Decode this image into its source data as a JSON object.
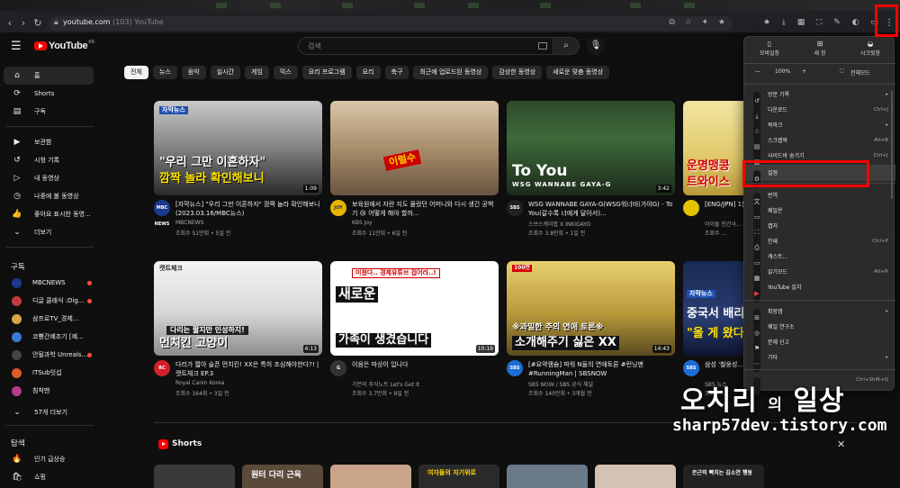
{
  "browser": {
    "url_host": "youtube.com",
    "url_tab": "(103) YouTube",
    "menu_icon": "kebab-icon"
  },
  "masthead": {
    "logo_text": "YouTube",
    "logo_region": "KR",
    "search_placeholder": "검색"
  },
  "sidebar": {
    "main": [
      {
        "label": "홈",
        "icon": "⌂"
      },
      {
        "label": "Shorts",
        "icon": "⟳"
      },
      {
        "label": "구독",
        "icon": "▤"
      }
    ],
    "library": [
      {
        "label": "보관함",
        "icon": "▶"
      },
      {
        "label": "시청 기록",
        "icon": "↺"
      },
      {
        "label": "내 동영상",
        "icon": "▷"
      },
      {
        "label": "나중에 볼 동영상",
        "icon": "◷"
      },
      {
        "label": "좋아요 표시한 동영...",
        "icon": "👍"
      },
      {
        "label": "더보기",
        "icon": "⌄"
      }
    ],
    "subs_title": "구독",
    "subs": [
      {
        "label": "MBCNEWS",
        "color": "#1a3a8f",
        "live": true
      },
      {
        "label": "디글 클래식 :Dig...",
        "color": "#c43a3a",
        "live": true
      },
      {
        "label": "삼프로TV_경제...",
        "color": "#d9a441",
        "live": false
      },
      {
        "label": "코빵간예조기 [예...",
        "color": "#3a7bd5",
        "live": false
      },
      {
        "label": "안될과학 Unreals...",
        "color": "#444444",
        "live": true
      },
      {
        "label": "ITSub잇섭",
        "color": "#e05a2a",
        "live": false
      },
      {
        "label": "침착맨",
        "color": "#b83c8c",
        "live": false
      },
      {
        "label": "57개 더보기",
        "color": "",
        "live": false
      }
    ],
    "explore_title": "탐색",
    "explore": [
      {
        "label": "인기 급상승",
        "icon": "🔥"
      },
      {
        "label": "쇼핑",
        "icon": "🛍"
      }
    ]
  },
  "chips": [
    "전체",
    "뉴스",
    "음악",
    "실시간",
    "게임",
    "믹스",
    "요리 프로그램",
    "요리",
    "축구",
    "최근에 업로드된 동영상",
    "감상한 동영상",
    "새로운 맞춤 동영상"
  ],
  "videos": [
    {
      "thumb_caption_1": "\"우리 그만 이혼하자\"",
      "thumb_caption_2": "깜짝 놀라 확인해보니",
      "thumb_tag": "자막뉴스",
      "duration": "1:09",
      "title": "[자막뉴스] \"우리 그만 이혼하자\" 깜짝 놀라 확인해보니 (2023.03.16/MBC뉴스)",
      "channel": "MBCNEWS",
      "stats": "조회수 51만회 • 5일 전",
      "avatar": "MBC NEWS",
      "avatar_color": "#1a3a8f"
    },
    {
      "thumb_caption_1": "이럴수",
      "thumb_caption_2": "",
      "thumb_tag": "",
      "duration": "",
      "title": "보육원에서 자란 지도 몰랐던 어머니와 다시 생긴 공백기 😢 어떻게 해야 할까...",
      "channel": "KBS Joy",
      "stats": "조회수 11만회 • 6일 전",
      "avatar": "JOY",
      "avatar_color": "#e8b400"
    },
    {
      "thumb_caption_1": "To You",
      "thumb_caption_2": "WSG WANNABE GAYA-G",
      "thumb_tag": "",
      "duration": "3:42",
      "title": "WSG WANNABE GAYA-G(WSG워너비(가야G) - To You(갈수록 너에게 달아서)...",
      "channel": "스브스케이팝 X INKIGAYO",
      "stats": "조회수 3.8만회 • 1일 전",
      "avatar": "SBS",
      "avatar_color": "#222222"
    },
    {
      "thumb_caption_1": "운명맹콩",
      "thumb_caption_2": "트와이스",
      "thumb_tag": "",
      "duration": "",
      "title": "[ENG/JPN] 1분 1초가 ...",
      "channel": "아이돌 인간극...",
      "stats": "조회수 ...",
      "avatar": "",
      "avatar_color": "#e6c300"
    },
    {
      "thumb_caption_1": "다리는 짧지만 인성하지!",
      "thumb_caption_2": "먼치킨 고양이",
      "thumb_tag": "캣트체크",
      "duration": "4:13",
      "title": "다리가 짧아 슬픈 먼치킨! XX은 특히 조심해야한다?! | 캣트체크 EP.3",
      "channel": "Royal Canin Korea",
      "stats": "조회수 164회 • 3일 전",
      "avatar": "RC",
      "avatar_color": "#d11f2b"
    },
    {
      "thumb_caption_1": "새로운",
      "thumb_caption_2": "가족이 생겼습니다",
      "thumb_tag": "미쳤다.. 경제유튜브 접어라..!",
      "duration": "10:19",
      "title": "이음은 따상이 입니다",
      "channel": "기븐의 주식노트 Let's Get It",
      "stats": "조회수 3.7만회 • 9일 전",
      "avatar": "G",
      "avatar_color": "#333333"
    },
    {
      "thumb_caption_1": "※과밀한 주의 연애 토론※",
      "thumb_caption_2": "소개해주기 싫은 XX",
      "thumb_tag": "100만",
      "duration": "14:43",
      "title": "[#요약캠슘] 파워 N들의 연애토론 #런닝맨 #RunningMan | SBSNOW",
      "channel": "SBS NOW / SBS 공식 채널",
      "stats": "조회수 140만회 • 3개월 전",
      "avatar": "SBS",
      "avatar_color": "#1c6ed6"
    },
    {
      "thumb_caption_1": "중국서 배리",
      "thumb_caption_2": "\"올 게 왔다",
      "thumb_tag": "자막뉴스",
      "duration": "",
      "title": "삼성 '철웅성...",
      "channel": "SBS 뉴스",
      "stats": "조회수 ...",
      "avatar": "SBS",
      "avatar_color": "#1c6ed6"
    }
  ],
  "shorts": {
    "title": "Shorts",
    "items": [
      "",
      "원터 다리 근육",
      "",
      "여자들의 자기위로",
      "",
      "",
      "은근히 빡치는 김소연 행동"
    ]
  },
  "edge_menu": {
    "top": [
      {
        "label": "모바일창",
        "icon": "▯"
      },
      {
        "label": "새 창",
        "icon": "⊞"
      },
      {
        "label": "시크릿창",
        "icon": "◒"
      }
    ],
    "zoom_label": "100%",
    "zoom_minus": "—",
    "zoom_plus": "+",
    "fullscreen": "전체모드",
    "items": [
      {
        "label": "방문 기록",
        "shortcut": "▸",
        "icon": "↺"
      },
      {
        "label": "다운로드",
        "shortcut": "Ctrl+J",
        "icon": "⤓"
      },
      {
        "label": "북마크",
        "shortcut": "▸",
        "icon": "☆"
      },
      {
        "label": "스크랩북",
        "shortcut": "Alt+B",
        "icon": "▤"
      },
      {
        "label": "사이드바 숨기기",
        "shortcut": "Ctrl+[",
        "icon": "▥"
      },
      {
        "label": "설정",
        "shortcut": "",
        "icon": "⚙"
      },
      {
        "label": "번역",
        "shortcut": "",
        "icon": "文"
      },
      {
        "label": "웨일온",
        "shortcut": "",
        "icon": "▭"
      },
      {
        "label": "캡처",
        "shortcut": "",
        "icon": "⛶"
      },
      {
        "label": "인쇄",
        "shortcut": "Ctrl+P",
        "icon": "⎙"
      },
      {
        "label": "캐스트...",
        "shortcut": "",
        "icon": "▭"
      },
      {
        "label": "읽기모드",
        "shortcut": "Alt+R",
        "icon": "▦"
      },
      {
        "label": "YouTube 설치",
        "shortcut": "",
        "icon": "▶"
      },
      {
        "label": "확장앱",
        "shortcut": "▸",
        "icon": "⊞"
      },
      {
        "label": "웨일 연구소",
        "shortcut": "",
        "icon": "◎"
      },
      {
        "label": "문제 신고",
        "shortcut": "",
        "icon": "⚑"
      },
      {
        "label": "기타",
        "shortcut": "▸",
        "icon": "⋯"
      },
      {
        "label": "",
        "shortcut": "Ctrl+Shift+Q",
        "icon": ""
      }
    ]
  },
  "watermark": {
    "line1_a": "오치리",
    "line1_b": "의",
    "line1_c": "일상",
    "line2": "sharp57dev.tistory.com"
  }
}
